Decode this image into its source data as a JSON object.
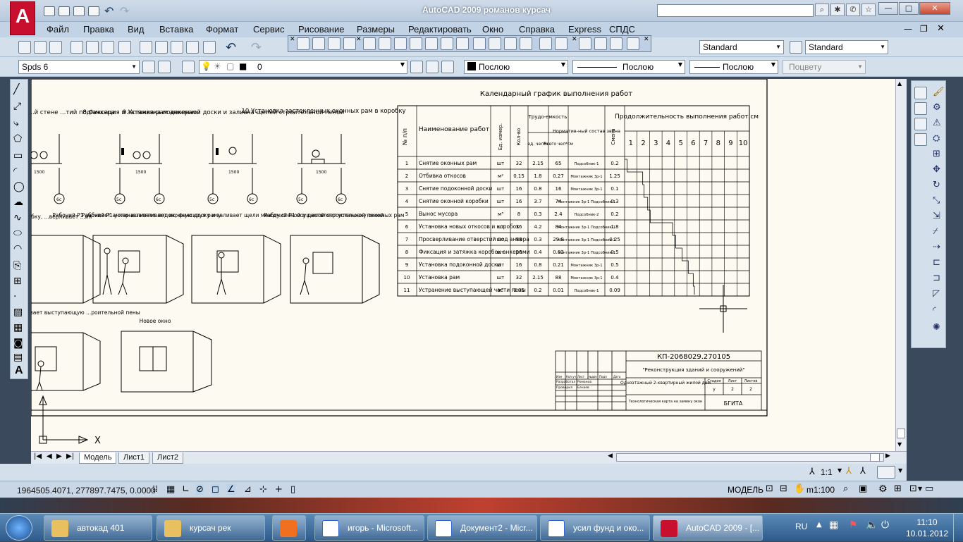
{
  "window": {
    "title": "AutoCAD 2009 романов курсач"
  },
  "menu": [
    "Файл",
    "Правка",
    "Вид",
    "Вставка",
    "Формат",
    "Сервис",
    "Рисование",
    "Размеры",
    "Редактировать",
    "Окно",
    "Справка",
    "Express",
    "СПДС"
  ],
  "toolbar": {
    "text_style": "Standard",
    "dim_style": "Standard",
    "workspace": "Spds 6",
    "layer": "0",
    "color": "Послою",
    "linetype": "Послою",
    "lineweight": "Послою",
    "plotstyle": "Поцвету"
  },
  "drawing": {
    "schedule_title": "Календарный график выполнения работ",
    "col_headers": {
      "num": "№ п/п",
      "name": "Наименование работ",
      "unit": "Ед. измер.",
      "qty": "Кол-во",
      "labor": "Трудо-емкость",
      "labor_unit": "ед. чел*ч",
      "labor_total": "Всего чел*см",
      "crew": "Норматив-ный состав звена",
      "shift": "Смена",
      "duration": "Продолжительность выполнения работ,см",
      "days": [
        "1",
        "2",
        "3",
        "4",
        "5",
        "6",
        "7",
        "8",
        "9",
        "10"
      ]
    },
    "rows": [
      {
        "n": "1",
        "name": "Снятие оконных рам",
        "unit": "шт",
        "qty": "32",
        "u": "2.15",
        "t": "65",
        "crew": "Подсобник-1",
        "s": "0.2"
      },
      {
        "n": "2",
        "name": "Отбивка откосов",
        "unit": "м²",
        "qty": "0.15",
        "u": "1.8",
        "t": "0.27",
        "crew": "Монтажник 3р-1",
        "s": "1.25"
      },
      {
        "n": "3",
        "name": "Снятие подоконной доски",
        "unit": "шт",
        "qty": "16",
        "u": "0.8",
        "t": "16",
        "crew": "Монтажник 3р-1",
        "s": "0.1"
      },
      {
        "n": "4",
        "name": "Снятие оконной коробки",
        "unit": "шт",
        "qty": "16",
        "u": "3.7",
        "t": "74",
        "crew": "Монтажник 3р-1 Подсобник-1",
        "s": "0.3"
      },
      {
        "n": "5",
        "name": "Вынос мусора",
        "unit": "м³",
        "qty": "8",
        "u": "0.3",
        "t": "2.4",
        "crew": "Подсобник-2",
        "s": "0.2"
      },
      {
        "n": "6",
        "name": "Установка новых откосов и коробок",
        "unit": "шт",
        "qty": "16",
        "u": "4.2",
        "t": "84",
        "crew": "Монтажник 3р-1 Подсобник-1",
        "s": "1.8"
      },
      {
        "n": "7",
        "name": "Просверливание отверстий под анкера",
        "unit": "шт",
        "qty": "98",
        "u": "0.3",
        "t": "29.8",
        "crew": "Монтажник 3р-1 Подсобник-1",
        "s": "0.25"
      },
      {
        "n": "8",
        "name": "Фиксация и затяжка коробок анкерами",
        "unit": "шт",
        "qty": "16",
        "u": "0.4",
        "t": "0.83",
        "crew": "Монтажник 3р-1 Подсобник-1",
        "s": "0.5"
      },
      {
        "n": "9",
        "name": "Установка подоконной доски",
        "unit": "шт",
        "qty": "16",
        "u": "0.8",
        "t": "0.21",
        "crew": "Монтажник 3р-1",
        "s": "0.5"
      },
      {
        "n": "10",
        "name": "Установка рам",
        "unit": "шт",
        "qty": "32",
        "u": "2.15",
        "t": "88",
        "crew": "Монтажник 3р-1",
        "s": "0.4"
      },
      {
        "n": "11",
        "name": "Устранение выступающей части пены",
        "unit": "м²",
        "qty": "0.05",
        "u": "0.2",
        "t": "0.01",
        "crew": "Подсобник-1",
        "s": "0.09"
      }
    ],
    "steps": [
      {
        "title": "...верливание в ...й стене ...тий под анкера"
      },
      {
        "title": "8.Фиксация и затяжка рам анкерами"
      },
      {
        "title": "9.Установка подоконной доски и заливка щелей строительной пеной"
      },
      {
        "title": "10.Установка застекленных оконных рам в коробку"
      }
    ],
    "captions": [
      "...рает коробку, ...верливает ...ия",
      "Рабочий Р1 забивает анкер и затягивает их, фиксируя раму",
      "Рабочий Р1 устанавливает подоконную доску и заливает щели между стеной и рамой строительной пеной",
      "Рабочий Р1 осуществляет установку оконных рам",
      "...ножом срезает выступающую ...роительной пены",
      "Новое окно"
    ],
    "dim": "1500",
    "axes": [
      "6с",
      "5с",
      "6с",
      "5с",
      "6с",
      "5с",
      "6с"
    ],
    "stamp": {
      "code": "КП-2068029.270105",
      "project": "\"Реконструкция зданий и сооружений\"",
      "building": "Одноэтажный 2-квартирный жилой дом",
      "org": "БГИТА",
      "sheet_labels": [
        "Стадия",
        "Лист",
        "Листов"
      ],
      "sheet_values": [
        "у",
        "2",
        "2"
      ],
      "subtitle": "Технологическая карта на замену окон",
      "roles": [
        "Разработал",
        "Проверил"
      ],
      "names": [
        "Романов",
        "Бачаев"
      ],
      "cols": [
        "Изм",
        "Кол.уч",
        "Лист",
        "№док",
        "Подп",
        "Дата"
      ]
    },
    "ucs_x": "X"
  },
  "tabs": [
    "Модель",
    "Лист1",
    "Лист2"
  ],
  "annot": {
    "scale": "1:1"
  },
  "status": {
    "coords": "1964505.4071, 277897.7475, 0.0000",
    "mode": "МОДЕЛЬ",
    "scale": "m1:100"
  },
  "taskbar": {
    "items": [
      "автокад 401",
      "курсач рек",
      "",
      "игорь - Microsoft...",
      "Документ2 - Micr...",
      "усил фунд и око...",
      "AutoCAD 2009 - [..."
    ],
    "lang": "RU",
    "time": "11:10",
    "date": "10.01.2012"
  }
}
